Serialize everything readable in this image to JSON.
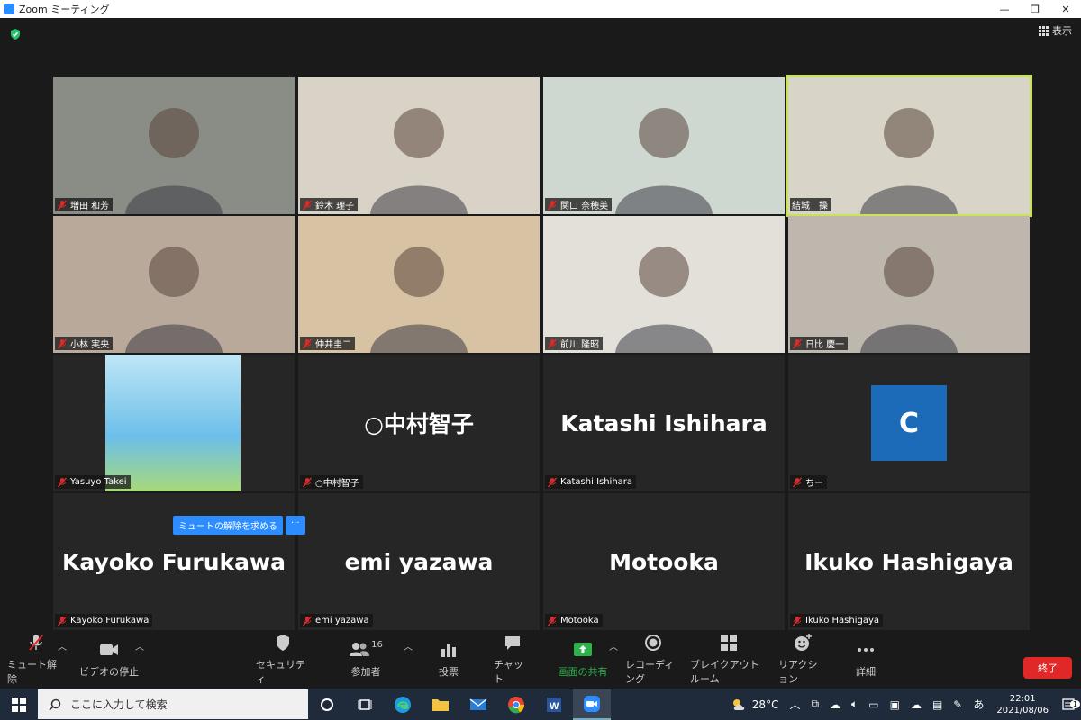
{
  "window": {
    "title": "Zoom ミーティング",
    "minimize": "—",
    "maximize": "❐",
    "close": "✕"
  },
  "view_button": {
    "label": "表示"
  },
  "tiles": [
    {
      "name": "増田 和芳",
      "muted": true,
      "active": false,
      "video": true,
      "bg": "#8a8c86"
    },
    {
      "name": "鈴木 理子",
      "muted": true,
      "active": false,
      "video": true,
      "bg": "#d9d2c6"
    },
    {
      "name": "関口 奈穂美",
      "muted": true,
      "active": false,
      "video": true,
      "bg": "#cfd8d0"
    },
    {
      "name": "結城　操",
      "muted": false,
      "active": true,
      "video": true,
      "bg": "#d8d4c8"
    },
    {
      "name": "小林 実央",
      "muted": true,
      "active": false,
      "video": true,
      "bg": "#b9a99a"
    },
    {
      "name": "仲井圭二",
      "muted": true,
      "active": false,
      "video": true,
      "bg": "#d8c2a4"
    },
    {
      "name": "前川 隆昭",
      "muted": true,
      "active": false,
      "video": true,
      "bg": "#e3e0da"
    },
    {
      "name": "日比 慶一",
      "muted": true,
      "active": false,
      "video": true,
      "bg": "#bdb7ad"
    },
    {
      "name": "Yasuyo Takei",
      "muted": true,
      "active": false,
      "video": true,
      "bg": "#7cc4ef"
    },
    {
      "name": "○中村智子",
      "muted": true,
      "active": false,
      "video": false,
      "display": "○中村智子"
    },
    {
      "name": "Katashi Ishihara",
      "muted": true,
      "active": false,
      "video": false,
      "display": "Katashi Ishihara"
    },
    {
      "name": "ちー",
      "muted": true,
      "active": false,
      "video": false,
      "avatar": "C"
    },
    {
      "name": "Kayoko Furukawa",
      "muted": true,
      "active": false,
      "video": false,
      "display": "Kayoko Furukawa"
    },
    {
      "name": "emi yazawa",
      "muted": true,
      "active": false,
      "video": false,
      "display": "emi yazawa"
    },
    {
      "name": "Motooka",
      "muted": true,
      "active": false,
      "video": false,
      "display": "Motooka"
    },
    {
      "name": "Ikuko Hashigaya",
      "muted": true,
      "active": false,
      "video": false,
      "display": "Ikuko Hashigaya"
    }
  ],
  "unmute_request": {
    "label": "ミュートの解除を求める",
    "more": "···"
  },
  "toolbar": {
    "unmute": "ミュート解除",
    "stop_video": "ビデオの停止",
    "security": "セキュリティ",
    "participants": "参加者",
    "participants_count": "16",
    "polls": "投票",
    "chat": "チャット",
    "share_screen": "画面の共有",
    "recording": "レコーディング",
    "breakout": "ブレイクアウトルーム",
    "reactions": "リアクション",
    "more": "詳細",
    "end": "終了"
  },
  "taskbar": {
    "search_placeholder": "ここに入力して検索",
    "weather": "28°C",
    "ime": "あ",
    "time": "22:01",
    "date": "2021/08/06",
    "notifications": "1"
  },
  "colors": {
    "accent": "#2d8cff",
    "active_speaker": "#c8e25a",
    "end": "#e02828",
    "avatar": "#1c6bb8"
  }
}
